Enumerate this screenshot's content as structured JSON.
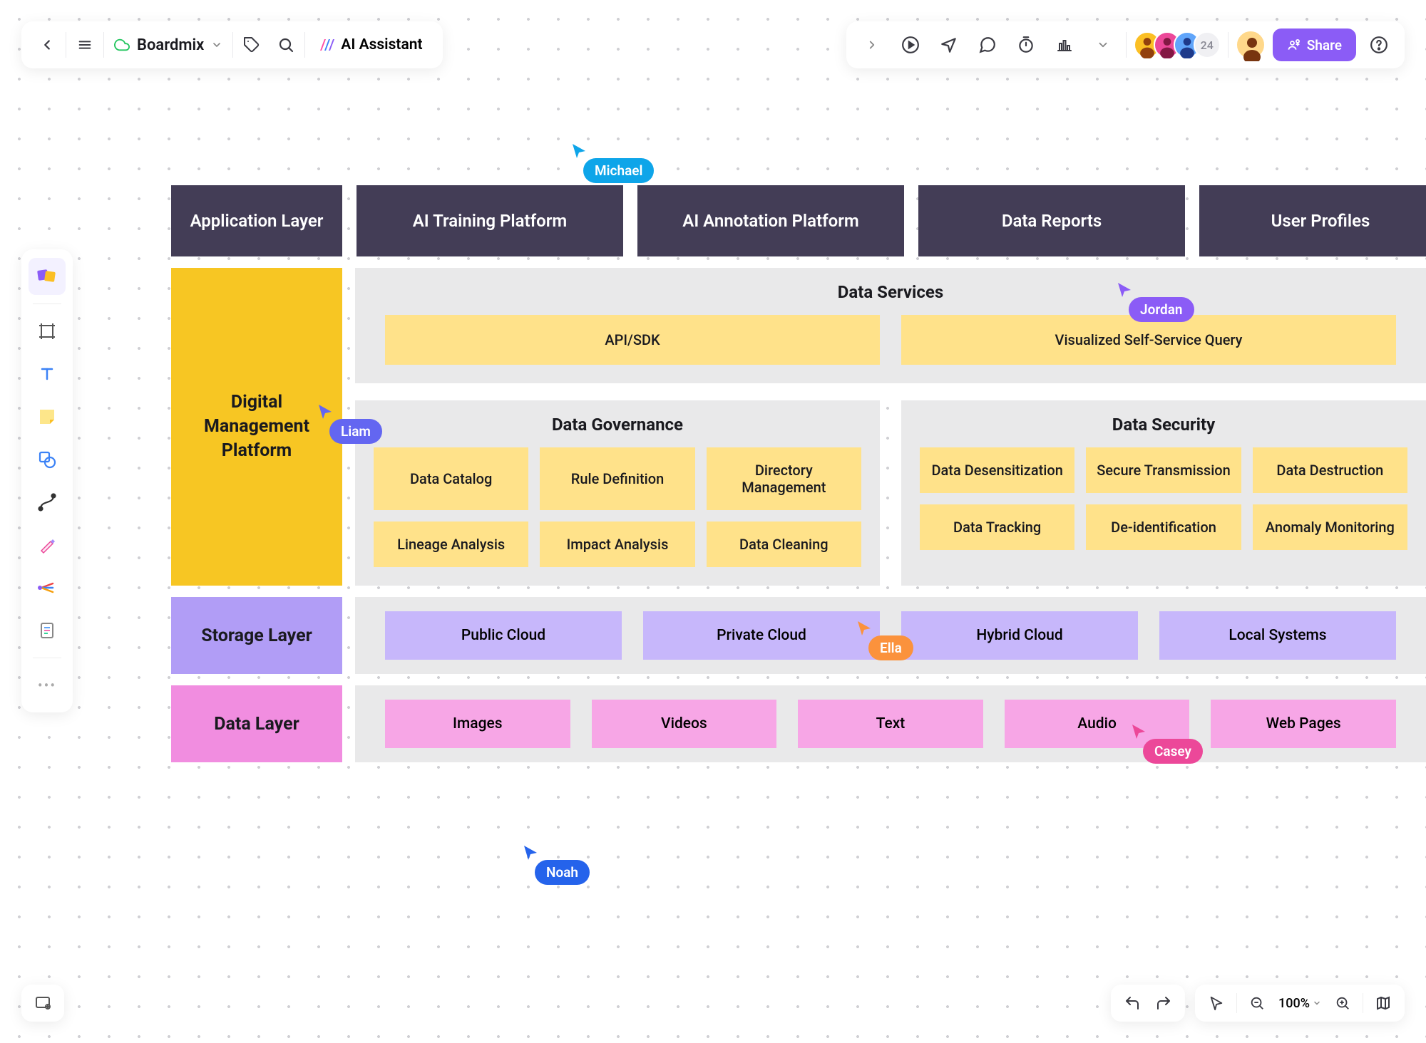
{
  "board": {
    "name": "Boardmix"
  },
  "ai_assistant": {
    "label": "AI Assistant"
  },
  "avatars": {
    "count": "24"
  },
  "share": {
    "label": "Share"
  },
  "zoom": {
    "label": "100%"
  },
  "headers": {
    "c1": "Application Layer",
    "c2": "AI Training Platform",
    "c3": "AI Annotation Platform",
    "c4": "Data Reports",
    "c5": "User Profiles"
  },
  "digital_platform": {
    "title": "Digital\nManagement\nPlatform"
  },
  "data_services": {
    "title": "Data Services",
    "items": {
      "api": "API/SDK",
      "query": "Visualized Self-Service Query"
    }
  },
  "governance": {
    "title": "Data Governance",
    "items": {
      "catalog": "Data Catalog",
      "rule": "Rule Definition",
      "directory": "Directory Management",
      "lineage": "Lineage Analysis",
      "impact": "Impact Analysis",
      "cleaning": "Data Cleaning"
    }
  },
  "security": {
    "title": "Data Security",
    "items": {
      "desens": "Data Desensitization",
      "transmission": "Secure Transmission",
      "destruction": "Data Destruction",
      "tracking": "Data Tracking",
      "deid": "De-identification",
      "anomaly": "Anomaly Monitoring"
    }
  },
  "storage": {
    "title": "Storage Layer",
    "items": {
      "public": "Public Cloud",
      "private": "Private Cloud",
      "hybrid": "Hybrid Cloud",
      "local": "Local Systems"
    }
  },
  "data_layer": {
    "title": "Data Layer",
    "items": {
      "images": "Images",
      "videos": "Videos",
      "text": "Text",
      "audio": "Audio",
      "web": "Web Pages"
    }
  },
  "cursors": {
    "michael": "Michael",
    "liam": "Liam",
    "jordan": "Jordan",
    "ella": "Ella",
    "casey": "Casey",
    "noah": "Noah"
  }
}
